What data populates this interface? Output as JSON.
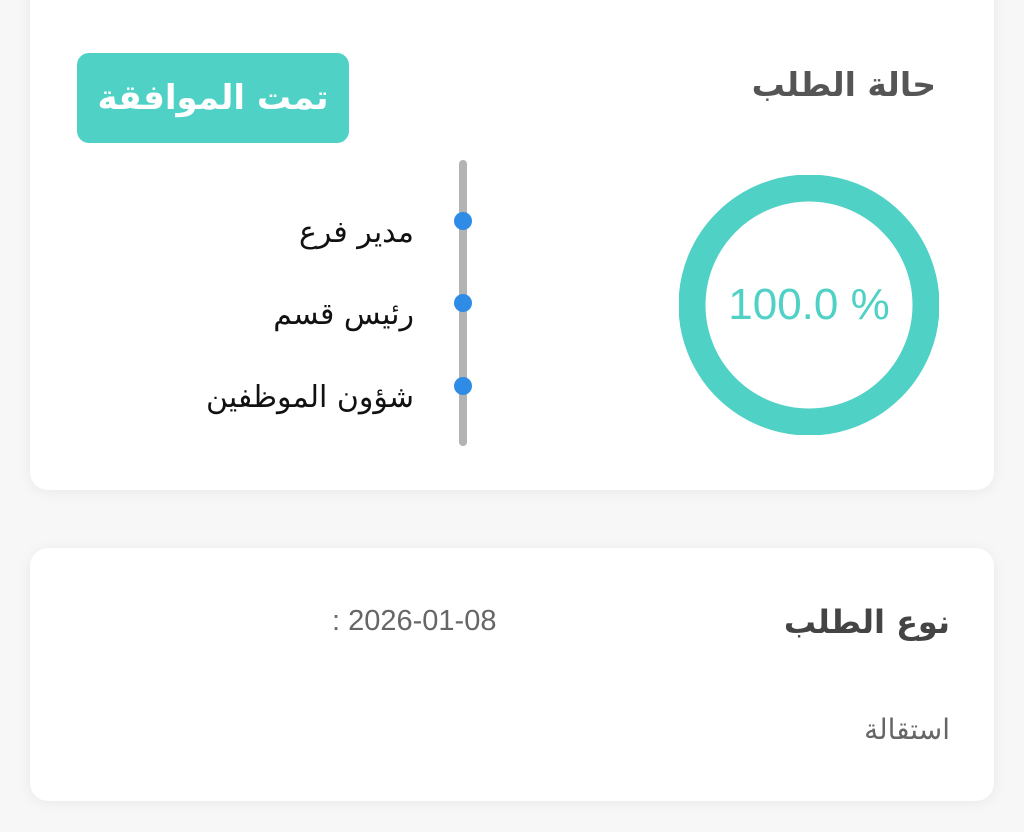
{
  "status_card": {
    "title": "حالة الطلب",
    "badge_label": "تمت الموافقة",
    "progress_percent": 100.0,
    "progress_text": "100.0 %",
    "timeline": [
      {
        "label": "مدير فرع"
      },
      {
        "label": "رئيس قسم"
      },
      {
        "label": "شؤون الموظفين"
      }
    ]
  },
  "request_card": {
    "title": "نوع الطلب",
    "date": ": 2026-01-08",
    "type_value": "استقالة"
  },
  "colors": {
    "accent": "#4fd1c5",
    "timeline_dot": "#2f8ce6",
    "timeline_bar": "#b3b3b3"
  }
}
